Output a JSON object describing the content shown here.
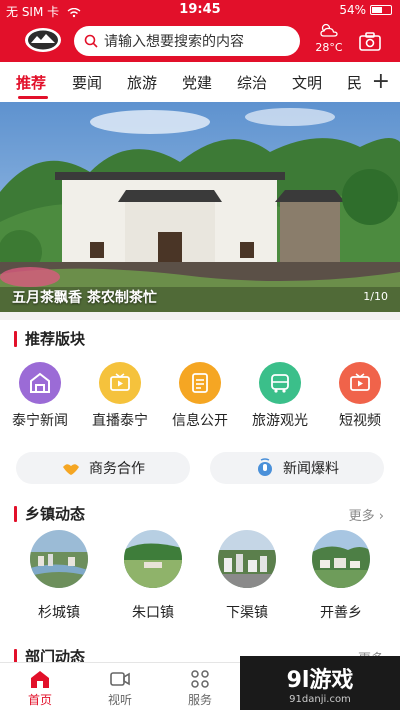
{
  "status": {
    "carrier": "无 SIM 卡",
    "time": "19:45",
    "battery": "54%",
    "battery_level": 0.54
  },
  "header": {
    "search_placeholder": "请输入想要搜索的内容",
    "temperature": "28°C",
    "brand_color": "#e2102a"
  },
  "tabs": [
    "推荐",
    "要闻",
    "旅游",
    "党建",
    "综治",
    "文明",
    "民"
  ],
  "banner": {
    "caption": "五月茶飘香 茶农制茶忙",
    "page": "1/10"
  },
  "recommend": {
    "title": "推荐版块",
    "items": [
      {
        "label": "泰宁新闻",
        "icon": "house-icon",
        "color": "#9b6bd6"
      },
      {
        "label": "直播泰宁",
        "icon": "tv-play-icon",
        "color": "#f5c23c"
      },
      {
        "label": "信息公开",
        "icon": "document-icon",
        "color": "#f5a623"
      },
      {
        "label": "旅游观光",
        "icon": "bus-icon",
        "color": "#3bbf8a"
      },
      {
        "label": "短视频",
        "icon": "video-icon",
        "color": "#f0634a"
      }
    ],
    "pills": [
      {
        "label": "商务合作",
        "icon": "handshake-icon"
      },
      {
        "label": "新闻爆料",
        "icon": "mic-icon"
      }
    ]
  },
  "towns": {
    "title": "乡镇动态",
    "more": "更多",
    "items": [
      {
        "label": "杉城镇"
      },
      {
        "label": "朱口镇"
      },
      {
        "label": "下渠镇"
      },
      {
        "label": "开善乡"
      }
    ]
  },
  "departments": {
    "title": "部门动态",
    "more": "更多"
  },
  "bottom_nav": [
    {
      "label": "首页",
      "icon": "home-icon"
    },
    {
      "label": "视听",
      "icon": "video-camera-icon"
    },
    {
      "label": "服务",
      "icon": "grid-icon"
    }
  ],
  "watermark": {
    "logo": "9l游戏",
    "url": "91danji.com"
  }
}
